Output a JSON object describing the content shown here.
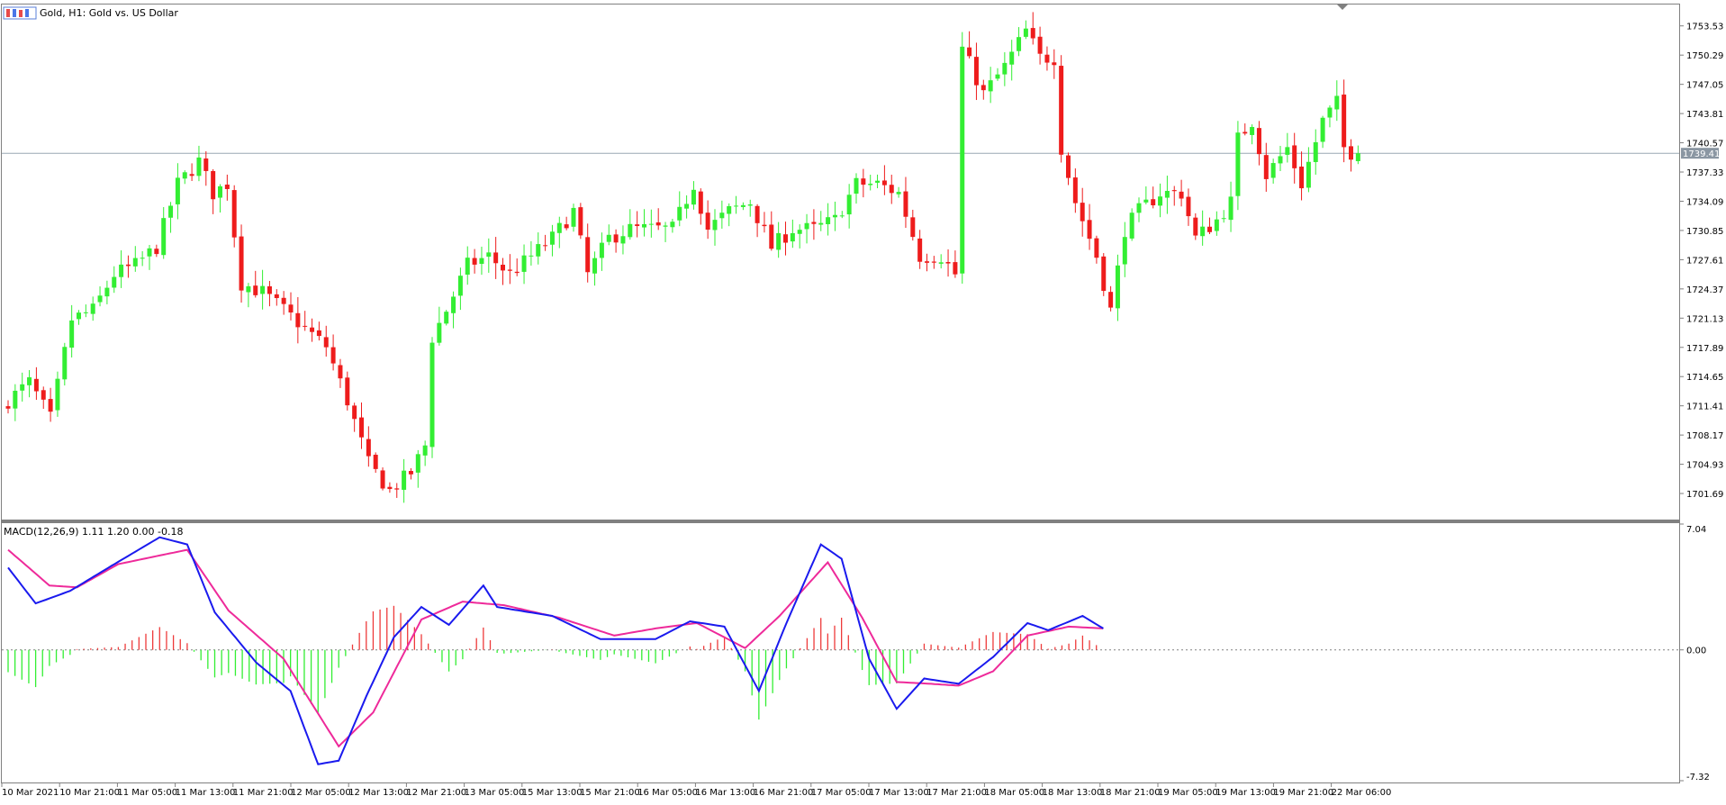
{
  "header": {
    "symbol": "Gold",
    "timeframe": "H1:",
    "description": "Gold vs. US Dollar"
  },
  "indicator": {
    "name": "MACD(12,26,9)",
    "values_text": "1.11 1.20 0.00 -0.18"
  },
  "colors": {
    "bull": "#33ee33",
    "bear": "#ee1c1c",
    "macd_line": "#1a1aee",
    "signal_line": "#ee2a9a",
    "hist_pos": "#ee3a3a",
    "hist_neg": "#33ee33",
    "frame": "#808080",
    "price_line": "#9aa8b4",
    "price_tag_bg": "#8a96a2"
  },
  "chart_data": [
    {
      "type": "candlestick",
      "current_price": 1739.41,
      "ylim": [
        1698.9,
        1755.8
      ],
      "y_ticks": [
        "1753.53",
        "1750.29",
        "1747.05",
        "1743.81",
        "1740.57",
        "1737.33",
        "1734.09",
        "1730.85",
        "1727.61",
        "1724.37",
        "1721.13",
        "1717.89",
        "1714.65",
        "1711.41",
        "1708.17",
        "1704.93",
        "1701.69"
      ],
      "x_labels": [
        "10 Mar 2021",
        "10 Mar 21:00",
        "11 Mar 05:00",
        "11 Mar 13:00",
        "11 Mar 21:00",
        "12 Mar 05:00",
        "12 Mar 13:00",
        "12 Mar 21:00",
        "13 Mar 05:00",
        "15 Mar 13:00",
        "15 Mar 21:00",
        "16 Mar 05:00",
        "16 Mar 13:00",
        "16 Mar 21:00",
        "17 Mar 05:00",
        "17 Mar 13:00",
        "17 Mar 21:00",
        "18 Mar 05:00",
        "18 Mar 13:00",
        "18 Mar 21:00",
        "19 Mar 05:00",
        "19 Mar 13:00",
        "19 Mar 21:00",
        "22 Mar 06:00"
      ],
      "anchors": [
        [
          0,
          1712
        ],
        [
          3,
          1714
        ],
        [
          6,
          1710
        ],
        [
          9,
          1721
        ],
        [
          12,
          1722
        ],
        [
          15,
          1726
        ],
        [
          18,
          1727
        ],
        [
          21,
          1729
        ],
        [
          24,
          1736
        ],
        [
          27,
          1738.5
        ],
        [
          29,
          1735
        ],
        [
          31,
          1736
        ],
        [
          33,
          1725
        ],
        [
          36,
          1724
        ],
        [
          39,
          1722
        ],
        [
          42,
          1720
        ],
        [
          45,
          1718
        ],
        [
          48,
          1712
        ],
        [
          51,
          1705
        ],
        [
          54,
          1702
        ],
        [
          57,
          1704
        ],
        [
          59,
          1707
        ],
        [
          60,
          1719
        ],
        [
          62,
          1722
        ],
        [
          65,
          1727
        ],
        [
          68,
          1728
        ],
        [
          71,
          1726
        ],
        [
          74,
          1728
        ],
        [
          77,
          1730
        ],
        [
          80,
          1733
        ],
        [
          82,
          1726
        ],
        [
          85,
          1730
        ],
        [
          88,
          1731
        ],
        [
          91,
          1731
        ],
        [
          94,
          1731
        ],
        [
          97,
          1736
        ],
        [
          99,
          1731
        ],
        [
          102,
          1733
        ],
        [
          105,
          1734
        ],
        [
          108,
          1729
        ],
        [
          111,
          1731
        ],
        [
          114,
          1731
        ],
        [
          117,
          1732
        ],
        [
          120,
          1736
        ],
        [
          123,
          1736
        ],
        [
          126,
          1735
        ],
        [
          129,
          1728
        ],
        [
          132,
          1728
        ],
        [
          134,
          1726
        ],
        [
          135,
          1751
        ],
        [
          138,
          1746
        ],
        [
          141,
          1749
        ],
        [
          144,
          1753
        ],
        [
          146,
          1750
        ],
        [
          148,
          1750
        ],
        [
          149,
          1740
        ],
        [
          151,
          1734
        ],
        [
          154,
          1728
        ],
        [
          156,
          1722
        ],
        [
          158,
          1731
        ],
        [
          160,
          1733
        ],
        [
          163,
          1735
        ],
        [
          166,
          1735
        ],
        [
          168,
          1730
        ],
        [
          171,
          1732
        ],
        [
          173,
          1734
        ],
        [
          174,
          1741
        ],
        [
          176,
          1743
        ],
        [
          178,
          1737
        ],
        [
          181,
          1740
        ],
        [
          183,
          1736
        ],
        [
          186,
          1743
        ],
        [
          188,
          1745
        ],
        [
          189,
          1740
        ],
        [
          191,
          1739
        ]
      ]
    },
    {
      "type": "macd",
      "params": "12,26,9",
      "ylim": [
        -7.32,
        7.04
      ],
      "y_ticks": [
        "7.04",
        "0.00",
        "-7.32"
      ],
      "macd_anchors": [
        [
          0,
          4.6
        ],
        [
          4,
          2.6
        ],
        [
          9,
          3.3
        ],
        [
          15,
          4.7
        ],
        [
          22,
          6.3
        ],
        [
          26,
          5.9
        ],
        [
          30,
          2.1
        ],
        [
          36,
          -0.7
        ],
        [
          41,
          -2.3
        ],
        [
          45,
          -6.4
        ],
        [
          48,
          -6.2
        ],
        [
          52,
          -2.6
        ],
        [
          56,
          0.7
        ],
        [
          60,
          2.4
        ],
        [
          64,
          1.4
        ],
        [
          69,
          3.6
        ],
        [
          71,
          2.4
        ],
        [
          79,
          1.9
        ],
        [
          86,
          0.6
        ],
        [
          94,
          0.6
        ],
        [
          99,
          1.6
        ],
        [
          104,
          1.3
        ],
        [
          109,
          -2.3
        ],
        [
          113,
          1.5
        ],
        [
          118,
          5.9
        ],
        [
          121,
          5.1
        ],
        [
          125,
          -0.5
        ],
        [
          129,
          -3.3
        ],
        [
          133,
          -1.6
        ],
        [
          138,
          -1.9
        ],
        [
          143,
          -0.4
        ],
        [
          148,
          1.5
        ],
        [
          151,
          1.1
        ],
        [
          156,
          1.9
        ],
        [
          159,
          1.2
        ]
      ],
      "signal_anchors": [
        [
          0,
          5.6
        ],
        [
          6,
          3.6
        ],
        [
          10,
          3.5
        ],
        [
          16,
          4.8
        ],
        [
          26,
          5.6
        ],
        [
          32,
          2.2
        ],
        [
          40,
          -0.5
        ],
        [
          48,
          -5.4
        ],
        [
          53,
          -3.5
        ],
        [
          60,
          1.7
        ],
        [
          66,
          2.7
        ],
        [
          72,
          2.5
        ],
        [
          80,
          1.8
        ],
        [
          88,
          0.8
        ],
        [
          94,
          1.2
        ],
        [
          100,
          1.5
        ],
        [
          107,
          0.1
        ],
        [
          112,
          1.9
        ],
        [
          119,
          4.9
        ],
        [
          124,
          1.8
        ],
        [
          129,
          -1.8
        ],
        [
          134,
          -1.9
        ],
        [
          138,
          -2.0
        ],
        [
          143,
          -1.2
        ],
        [
          148,
          0.8
        ],
        [
          154,
          1.3
        ],
        [
          159,
          1.2
        ]
      ]
    }
  ]
}
